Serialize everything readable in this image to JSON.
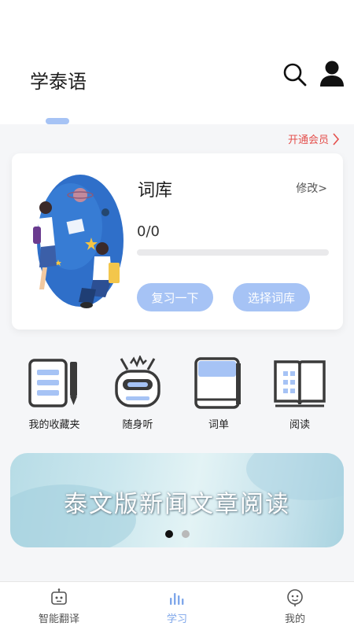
{
  "header": {
    "title": "学泰语",
    "search_icon": "search-icon",
    "user_icon": "user-icon"
  },
  "vip": {
    "label": "开通会员"
  },
  "vocab_card": {
    "title": "词库",
    "edit_label": "修改>",
    "progress_text": "0/0",
    "progress_fraction": 0,
    "review_button": "复习一下",
    "select_button": "选择词库"
  },
  "features": [
    {
      "label": "我的收藏夹",
      "icon": "notebook-pen-icon"
    },
    {
      "label": "随身听",
      "icon": "robot-icon"
    },
    {
      "label": "词单",
      "icon": "book-icon"
    },
    {
      "label": "阅读",
      "icon": "open-book-icon"
    }
  ],
  "banner": {
    "text": "泰文版新闻文章阅读",
    "active_dot": 0,
    "dot_count": 2
  },
  "bottom_nav": [
    {
      "label": "智能翻译",
      "icon": "robot-head-icon",
      "active": false
    },
    {
      "label": "学习",
      "icon": "bars-icon",
      "active": true
    },
    {
      "label": "我的",
      "icon": "face-icon",
      "active": false
    }
  ],
  "colors": {
    "accent": "#a6c3f5",
    "vip": "#e4504d",
    "nav_active": "#7fa7ea",
    "icon_dark": "#3a3a3a"
  }
}
